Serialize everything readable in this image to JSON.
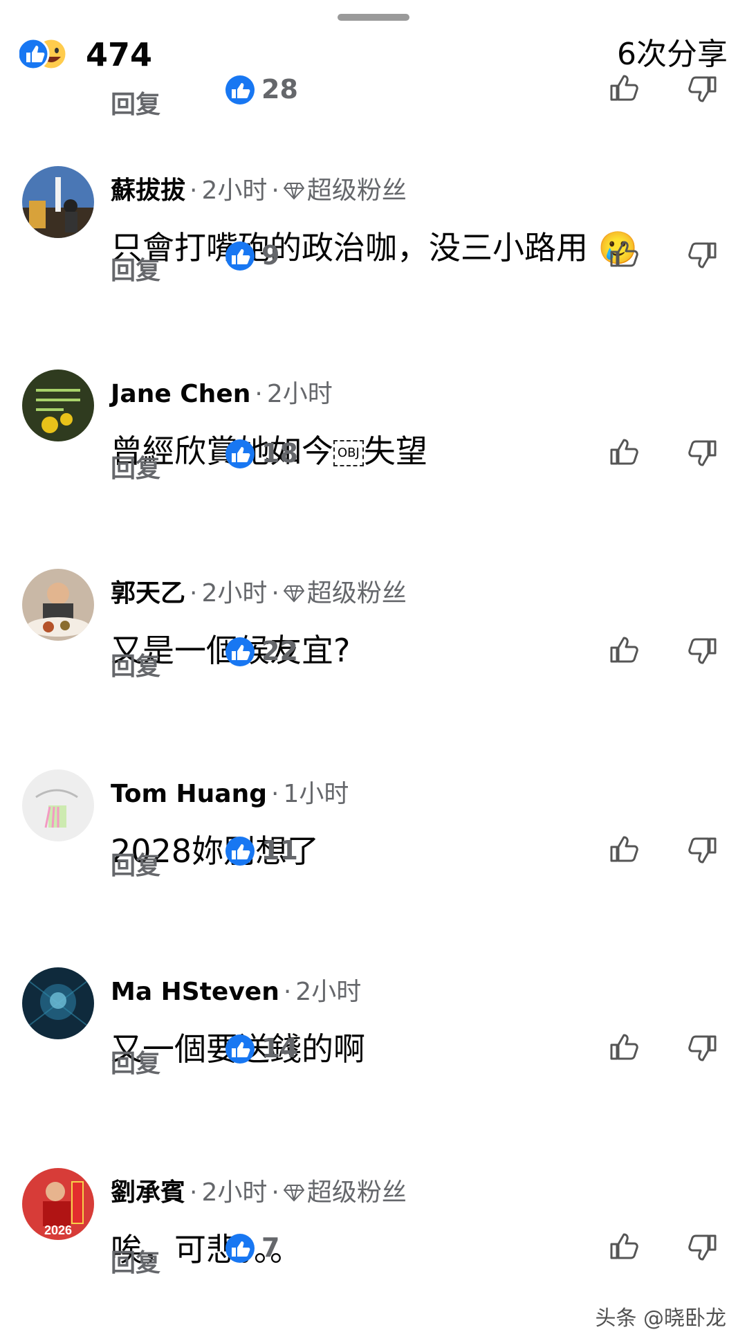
{
  "post": {
    "reaction_count": "474",
    "shares": "6次分享",
    "first_reply_row": {
      "reply_label": "回复",
      "likes": "28"
    }
  },
  "comments": [
    {
      "author": "蘇拔拔",
      "time": "2小时",
      "badge": "超级粉丝",
      "text": "只會打嘴砲的政治咖，没三小路用",
      "emoji": "🥲",
      "reply_label": "回复",
      "likes": "9"
    },
    {
      "author": "Jane Chen",
      "time": "2小时",
      "text_before": "曾經欣賞她如今",
      "obj": "OBJ",
      "text_after": "失望",
      "reply_label": "回复",
      "likes": "18"
    },
    {
      "author": "郭天乙",
      "time": "2小时",
      "badge": "超级粉丝",
      "text": "又是一個候友宜?",
      "reply_label": "回复",
      "likes": "22"
    },
    {
      "author": "Tom Huang",
      "time": "1小时",
      "text": "2028妳別想了",
      "reply_label": "回复",
      "likes": "11"
    },
    {
      "author": "Ma HSteven",
      "time": "2小时",
      "text": "又一個要送錢的啊",
      "reply_label": "回复",
      "likes": "14"
    },
    {
      "author": "劉承賓",
      "time": "2小时",
      "badge": "超级粉丝",
      "text": "唉，可悲。。。",
      "avatar_label": "2026",
      "reply_label": "回复",
      "likes": "7"
    }
  ],
  "watermark": "头条 @晓卧龙",
  "colors": {
    "like_blue": "#1877f2",
    "secondary_text": "#65676b"
  }
}
